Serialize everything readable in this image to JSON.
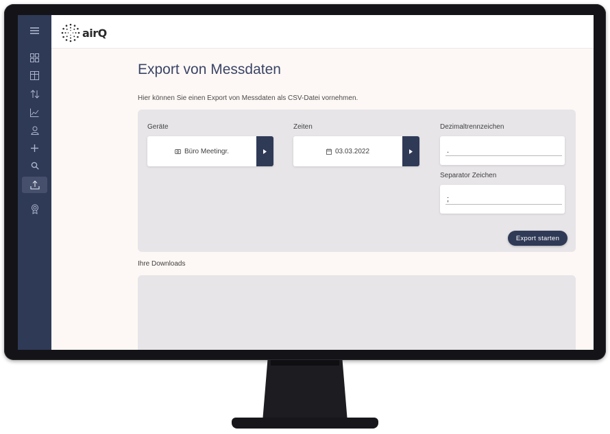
{
  "app": {
    "brand": "airQ"
  },
  "sidebar": {
    "items": [
      {
        "name": "menu",
        "glyph": "≡"
      },
      {
        "name": "dashboard-icon"
      },
      {
        "name": "table-icon"
      },
      {
        "name": "sort-icon"
      },
      {
        "name": "chart-icon"
      },
      {
        "name": "user-icon"
      },
      {
        "name": "add-icon",
        "glyph": "+"
      },
      {
        "name": "search-icon"
      },
      {
        "name": "export-icon",
        "active": true
      },
      {
        "name": "award-icon"
      }
    ]
  },
  "page": {
    "title": "Export von Messdaten",
    "description": "Hier können Sie einen Export von Messdaten als CSV-Datei vornehmen."
  },
  "form": {
    "devices": {
      "label": "Geräte",
      "value": "Büro Meetingr.",
      "icon": "device-icon"
    },
    "times": {
      "label": "Zeiten",
      "value": "03.03.2022",
      "icon": "calendar-icon"
    },
    "decimal": {
      "label": "Dezimaltrennzeichen",
      "value": "."
    },
    "separator": {
      "label": "Separator Zeichen",
      "value": ";"
    },
    "export_button": "Export starten"
  },
  "downloads": {
    "label": "Ihre Downloads"
  },
  "colors": {
    "sidebar": "#2f3a57",
    "accent": "#2f3a57",
    "panel": "#e7e5e8",
    "background": "#fdf8f5"
  }
}
